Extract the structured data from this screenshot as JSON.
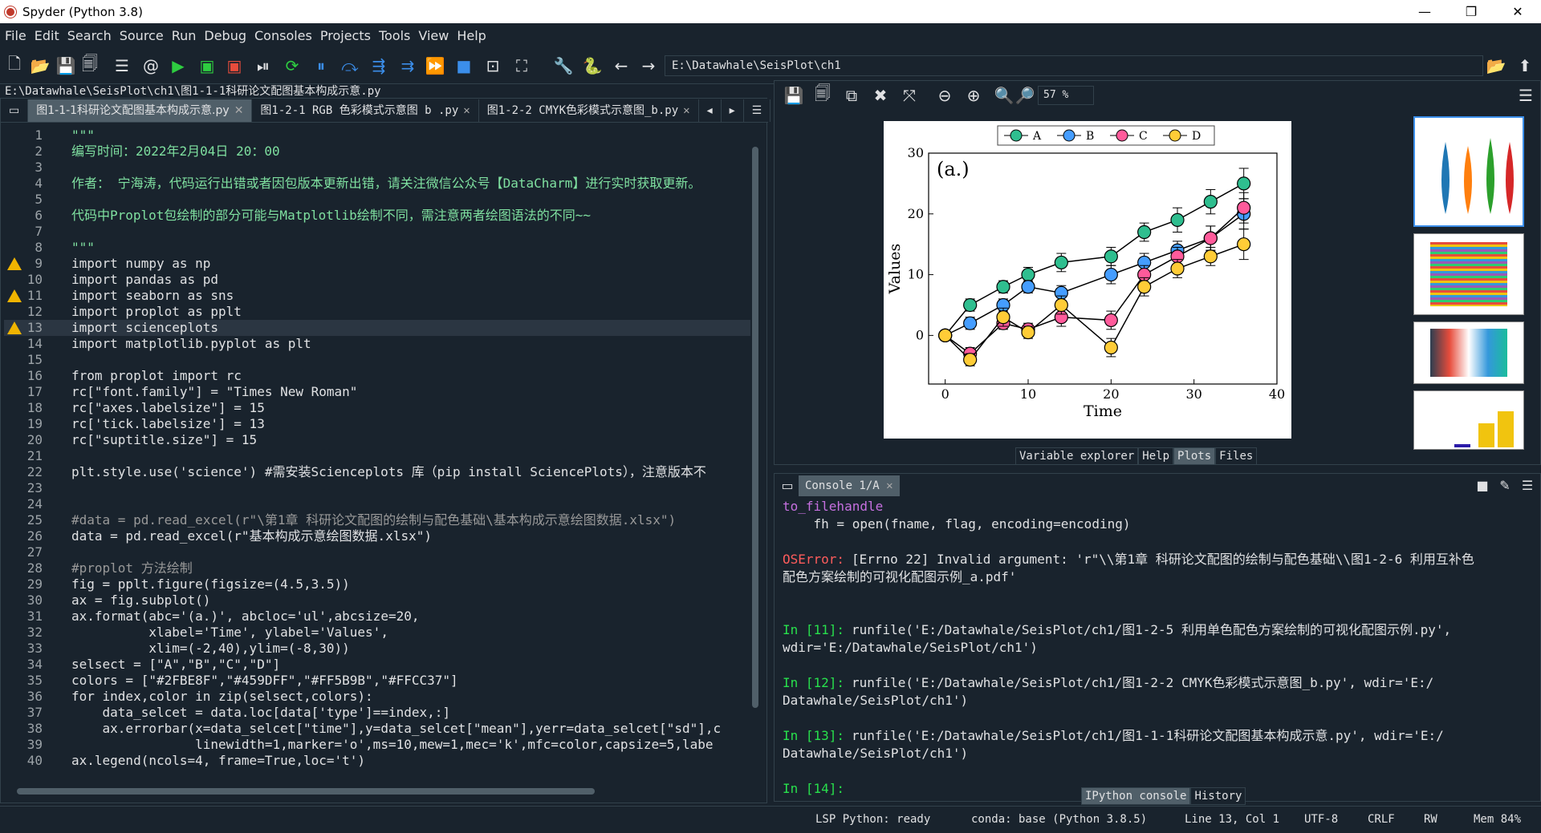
{
  "window": {
    "title": "Spyder (Python 3.8)",
    "controls": [
      "—",
      "❐",
      "✕"
    ]
  },
  "menu": [
    "File",
    "Edit",
    "Search",
    "Source",
    "Run",
    "Debug",
    "Consoles",
    "Projects",
    "Tools",
    "View",
    "Help"
  ],
  "toolbar": {
    "path": "E:\\Datawhale\\SeisPlot\\ch1"
  },
  "editor": {
    "file_path": "E:\\Datawhale\\SeisPlot\\ch1\\图1-1-1科研论文配图基本构成示意.py",
    "tabs": [
      "图1-1-1科研论文配图基本构成示意.py",
      "图1-2-1 RGB 色彩模式示意图 b .py",
      "图1-2-2 CMYK色彩模式示意图_b.py"
    ],
    "lines": [
      {
        "n": "1",
        "t": "\"\"\""
      },
      {
        "n": "2",
        "t": "编写时间：2022年2月04日 20：00"
      },
      {
        "n": "3",
        "t": ""
      },
      {
        "n": "4",
        "t": "作者： 宁海涛，代码运行出错或者因包版本更新出错，请关注微信公众号【DataCharm】进行实时获取更新。"
      },
      {
        "n": "5",
        "t": ""
      },
      {
        "n": "6",
        "t": "代码中Proplot包绘制的部分可能与Matplotlib绘制不同，需注意两者绘图语法的不同~~"
      },
      {
        "n": "7",
        "t": ""
      },
      {
        "n": "8",
        "t": "\"\"\""
      },
      {
        "n": "9",
        "t": "import numpy as np"
      },
      {
        "n": "10",
        "t": "import pandas as pd"
      },
      {
        "n": "11",
        "t": "import seaborn as sns"
      },
      {
        "n": "12",
        "t": "import proplot as pplt"
      },
      {
        "n": "13",
        "t": "import scienceplots"
      },
      {
        "n": "14",
        "t": "import matplotlib.pyplot as plt"
      },
      {
        "n": "15",
        "t": ""
      },
      {
        "n": "16",
        "t": "from proplot import rc"
      },
      {
        "n": "17",
        "t": "rc[\"font.family\"] = \"Times New Roman\""
      },
      {
        "n": "18",
        "t": "rc[\"axes.labelsize\"] = 15"
      },
      {
        "n": "19",
        "t": "rc['tick.labelsize'] = 13"
      },
      {
        "n": "20",
        "t": "rc[\"suptitle.size\"] = 15"
      },
      {
        "n": "21",
        "t": ""
      },
      {
        "n": "22",
        "t": "plt.style.use('science') #需安装Scienceplots 库（pip install SciencePlots），注意版本不"
      },
      {
        "n": "23",
        "t": ""
      },
      {
        "n": "24",
        "t": ""
      },
      {
        "n": "25",
        "t": "#data = pd.read_excel(r\"\\第1章 科研论文配图的绘制与配色基础\\基本构成示意绘图数据.xlsx\")"
      },
      {
        "n": "26",
        "t": "data = pd.read_excel(r\"基本构成示意绘图数据.xlsx\")"
      },
      {
        "n": "27",
        "t": ""
      },
      {
        "n": "28",
        "t": "#proplot 方法绘制"
      },
      {
        "n": "29",
        "t": "fig = pplt.figure(figsize=(4.5,3.5))"
      },
      {
        "n": "30",
        "t": "ax = fig.subplot()"
      },
      {
        "n": "31",
        "t": "ax.format(abc='(a.)', abcloc='ul',abcsize=20,"
      },
      {
        "n": "32",
        "t": "          xlabel='Time', ylabel='Values',"
      },
      {
        "n": "33",
        "t": "          xlim=(-2,40),ylim=(-8,30))"
      },
      {
        "n": "34",
        "t": "selsect = [\"A\",\"B\",\"C\",\"D\"]"
      },
      {
        "n": "35",
        "t": "colors = [\"#2FBE8F\",\"#459DFF\",\"#FF5B9B\",\"#FFCC37\"]"
      },
      {
        "n": "36",
        "t": "for index,color in zip(selsect,colors):"
      },
      {
        "n": "37",
        "t": "    data_selcet = data.loc[data['type']==index,:]"
      },
      {
        "n": "38",
        "t": "    ax.errorbar(x=data_selcet[\"time\"],y=data_selcet[\"mean\"],yerr=data_selcet[\"sd\"],c"
      },
      {
        "n": "39",
        "t": "                linewidth=1,marker='o',ms=10,mew=1,mec='k',mfc=color,capsize=5,labe"
      },
      {
        "n": "40",
        "t": "ax.legend(ncols=4, frame=True,loc='t')"
      }
    ]
  },
  "plots": {
    "zoom": "57 %",
    "chart_data": {
      "type": "line",
      "title": "",
      "panel_label": "(a.)",
      "xlabel": "Time",
      "ylabel": "Values",
      "xlim": [
        -2,
        40
      ],
      "ylim": [
        -8,
        30
      ],
      "xticks": [
        "0",
        "10",
        "20",
        "30",
        "40"
      ],
      "yticks": [
        "0",
        "10",
        "20",
        "30"
      ],
      "legend": "top",
      "x": [
        0,
        3,
        7,
        10,
        14,
        20,
        24,
        28,
        32,
        36
      ],
      "series": [
        {
          "name": "A",
          "color": "#2FBE8F",
          "values": [
            0,
            5,
            8,
            10,
            12,
            13,
            17,
            19,
            22,
            25
          ],
          "err": [
            0.5,
            1,
            1,
            1.2,
            1.5,
            1.5,
            1.5,
            2,
            2,
            2.5
          ]
        },
        {
          "name": "B",
          "color": "#459DFF",
          "values": [
            0,
            2,
            5,
            8,
            7,
            10,
            12,
            14,
            16,
            20
          ],
          "err": [
            0.5,
            1,
            1,
            1,
            1.2,
            1.5,
            1.5,
            1.5,
            2,
            2.5
          ]
        },
        {
          "name": "C",
          "color": "#FF5B9B",
          "values": [
            0,
            -3,
            2,
            1,
            3,
            2.5,
            10,
            13,
            16,
            21
          ],
          "err": [
            0.5,
            1,
            1,
            1,
            1.5,
            1.5,
            1.5,
            1.5,
            2,
            2.5
          ]
        },
        {
          "name": "D",
          "color": "#FFCC37",
          "values": [
            0,
            -4,
            3,
            0.5,
            5,
            -2,
            8,
            11,
            13,
            15
          ],
          "err": [
            0.5,
            1,
            1.5,
            1,
            1.5,
            1.5,
            1.5,
            1.5,
            1.5,
            2.5
          ]
        }
      ]
    },
    "pane_tabs": [
      "Variable explorer",
      "Help",
      "Plots",
      "Files"
    ]
  },
  "console": {
    "tab": "Console 1/A",
    "lines": [
      {
        "cls": "kw",
        "t": "to_filehandle"
      },
      {
        "cls": "",
        "t": "    fh = open(fname, flag, encoding=encoding)"
      },
      {
        "cls": "",
        "t": ""
      },
      {
        "cls": "err",
        "t": "OSError:"
      },
      {
        "cls": "",
        "t": "[Errno 22] Invalid argument: 'r\"\\\\第1章 科研论文配图的绘制与配色基础\\\\图1-2-6 利用互补色"
      },
      {
        "cls": "",
        "t": "配色方案绘制的可视化配图示例_a.pdf'"
      },
      {
        "cls": "",
        "t": ""
      },
      {
        "cls": "",
        "t": ""
      },
      {
        "cls": "in",
        "t": "In [11]:"
      },
      {
        "cls": "",
        "t": "runfile('E:/Datawhale/SeisPlot/ch1/图1-2-5 利用单色配色方案绘制的可视化配图示例.py',"
      },
      {
        "cls": "",
        "t": "wdir='E:/Datawhale/SeisPlot/ch1')"
      },
      {
        "cls": "",
        "t": ""
      },
      {
        "cls": "in",
        "t": "In [12]:"
      },
      {
        "cls": "",
        "t": "runfile('E:/Datawhale/SeisPlot/ch1/图1-2-2 CMYK色彩模式示意图_b.py', wdir='E:/"
      },
      {
        "cls": "",
        "t": "Datawhale/SeisPlot/ch1')"
      },
      {
        "cls": "",
        "t": ""
      },
      {
        "cls": "in",
        "t": "In [13]:"
      },
      {
        "cls": "",
        "t": "runfile('E:/Datawhale/SeisPlot/ch1/图1-1-1科研论文配图基本构成示意.py', wdir='E:/"
      },
      {
        "cls": "",
        "t": "Datawhale/SeisPlot/ch1')"
      },
      {
        "cls": "",
        "t": ""
      },
      {
        "cls": "in",
        "t": "In [14]:"
      }
    ],
    "bottom_tabs": [
      "IPython console",
      "History"
    ]
  },
  "status": {
    "lsp": "LSP Python: ready",
    "conda": "conda: base (Python 3.8.5)",
    "pos": "Line 13, Col 1",
    "enc": "UTF-8",
    "eol": "CRLF",
    "rw": "RW",
    "mem": "Mem 84%"
  }
}
